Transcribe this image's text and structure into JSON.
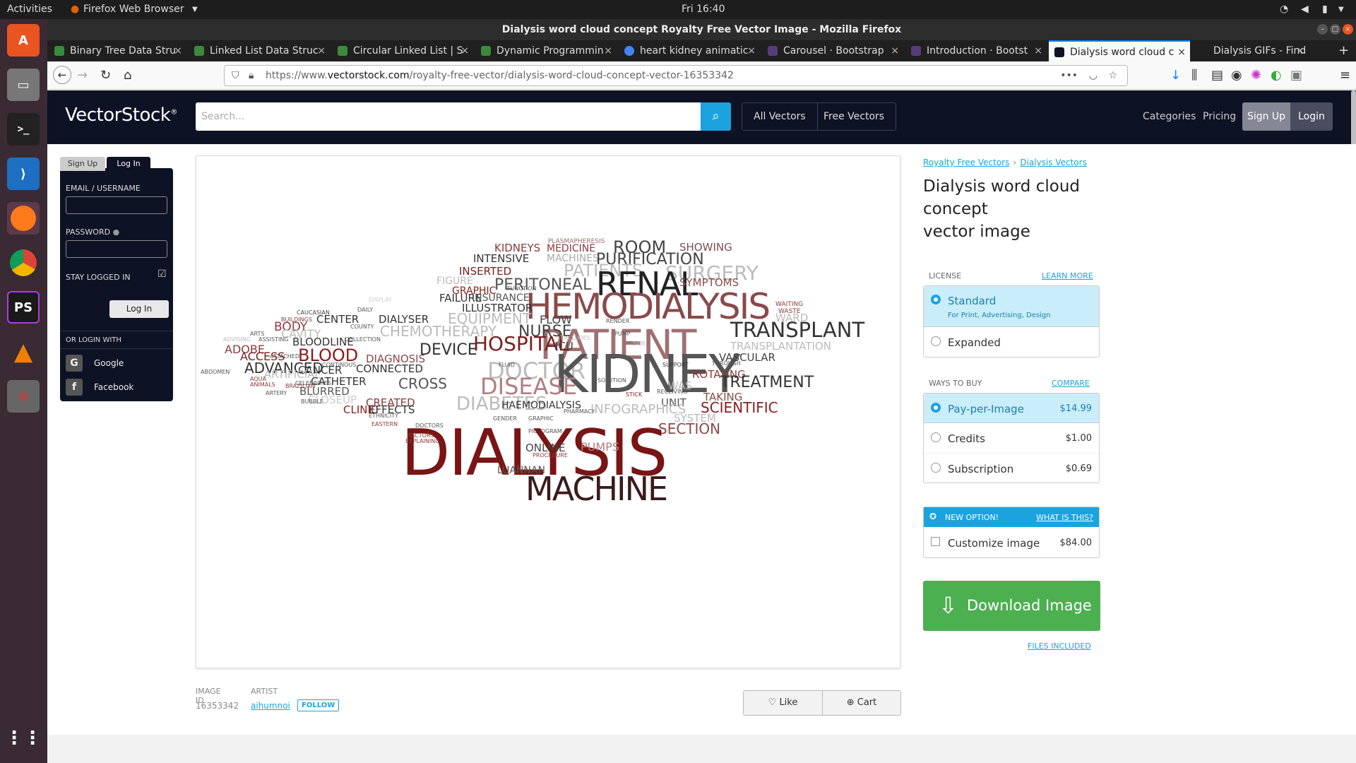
{
  "topbar": {
    "activities": "Activities",
    "app": "Firefox Web Browser",
    "clock": "Fri 16:40"
  },
  "window": {
    "title": "Dialysis word cloud concept Royalty Free Vector Image - Mozilla Firefox"
  },
  "tabs": [
    {
      "label": "Binary Tree Data Stru"
    },
    {
      "label": "Linked List Data Struc"
    },
    {
      "label": "Circular Linked List | S"
    },
    {
      "label": "Dynamic Programmin"
    },
    {
      "label": "heart kidney animatic"
    },
    {
      "label": "Carousel · Bootstrap"
    },
    {
      "label": "Introduction · Bootst"
    },
    {
      "label": "Dialysis word cloud c"
    },
    {
      "label": "Dialysis GIFs - Find &"
    }
  ],
  "url": {
    "prefix": "https://www.",
    "domain": "vectorstock.com",
    "path": "/royalty-free-vector/dialysis-word-cloud-concept-vector-16353342"
  },
  "site": {
    "logo": "VectorStock",
    "logo_mark": "®",
    "search_placeholder": "Search...",
    "all_vectors": "All Vectors",
    "free_vectors": "Free Vectors",
    "categories": "Categories",
    "pricing": "Pricing",
    "sign_up": "Sign Up",
    "login": "Login"
  },
  "login_panel": {
    "tab_signup": "Sign Up",
    "tab_login": "Log In",
    "email_label": "EMAIL / USERNAME",
    "password_label": "PASSWORD",
    "stay_logged": "STAY LOGGED IN",
    "login_btn": "Log In",
    "or_login": "OR LOGIN WITH",
    "google": "Google",
    "facebook": "Facebook"
  },
  "meta": {
    "image_id_label": "IMAGE ID",
    "image_id": "16353342",
    "artist_label": "ARTIST",
    "artist": "aihumnoi",
    "follow": "FOLLOW",
    "like": "Like",
    "cart": "Cart"
  },
  "details": {
    "crumb1": "Royalty Free Vectors",
    "crumb_sep": "›",
    "crumb2": "Dialysis Vectors",
    "title1": "Dialysis word cloud",
    "title2": "concept",
    "title3": "vector image",
    "license_label": "LICENSE",
    "learn_more": "LEARN MORE",
    "standard": "Standard",
    "standard_sub": "For Print, Advertising, Design",
    "expanded": "Expanded",
    "ways_label": "WAYS TO BUY",
    "compare": "COMPARE",
    "ppi": "Pay-per-Image",
    "ppi_price": "$14.99",
    "credits": "Credits",
    "credits_price": "$1.00",
    "subscription": "Subscription",
    "subscription_price": "$0.69",
    "new_option": "NEW OPTION!",
    "what_is": "WHAT IS THIS?",
    "customize": "Customize image",
    "customize_price": "$84.00",
    "download": "Download Image",
    "files_included": "FILES INCLUDED"
  },
  "cloud_words": [
    {
      "t": "KIDNEYS",
      "c": "#8a3a3a"
    },
    {
      "t": "PLASMAPHERESIS",
      "c": "#9b6b6b"
    },
    {
      "t": "ROOM",
      "c": "#444"
    },
    {
      "t": "SHOWING",
      "c": "#7a5050"
    },
    {
      "t": "INTENSIVE",
      "c": "#333"
    },
    {
      "t": "MACHINES",
      "c": "#aaa"
    },
    {
      "t": "MEDICINE",
      "c": "#8a3a3a"
    },
    {
      "t": "PURIFICATION",
      "c": "#444"
    },
    {
      "t": "PATIENTS",
      "c": "#bbb"
    },
    {
      "t": "SURGERY",
      "c": "#bbb"
    },
    {
      "t": "INSERTED",
      "c": "#7a2020"
    },
    {
      "t": "RENAL",
      "c": "#222"
    },
    {
      "t": "FIGURE",
      "c": "#bbb"
    },
    {
      "t": "PERITONEAL",
      "c": "#555"
    },
    {
      "t": "SYMPTOMS",
      "c": "#8a4a4a"
    },
    {
      "t": "GRAPHIC",
      "c": "#8a2020"
    },
    {
      "t": "FUNCTION",
      "c": "#555"
    },
    {
      "t": "HEMODIALYSIS",
      "c": "#8a4a4a"
    },
    {
      "t": "FAILURE",
      "c": "#333"
    },
    {
      "t": "INSURANCE",
      "c": "#555"
    },
    {
      "t": "ILLUSTRATOR",
      "c": "#333"
    },
    {
      "t": "WAITING",
      "c": "#8a3a3a"
    },
    {
      "t": "WASTE",
      "c": "#8a3a3a"
    },
    {
      "t": "DISPLAY",
      "c": "#ccc"
    },
    {
      "t": "WARD",
      "c": "#bbb"
    },
    {
      "t": "CAUCASIAN",
      "c": "#444"
    },
    {
      "t": "DAILY",
      "c": "#555"
    },
    {
      "t": "EQUIPMENT",
      "c": "#bbb"
    },
    {
      "t": "FLOW",
      "c": "#444"
    },
    {
      "t": "BUILDINGS",
      "c": "#8a3a3a"
    },
    {
      "t": "CENTER",
      "c": "#333"
    },
    {
      "t": "DIALYSER",
      "c": "#333"
    },
    {
      "t": "RENDER",
      "c": "#555"
    },
    {
      "t": "PATIENT",
      "c": "#a07070"
    },
    {
      "t": "TRANSPLANT",
      "c": "#333"
    },
    {
      "t": "BODY",
      "c": "#8a3a3a"
    },
    {
      "t": "COUNTY",
      "c": "#555"
    },
    {
      "t": "CHEMOTHERAPY",
      "c": "#bbb"
    },
    {
      "t": "NURSE",
      "c": "#444"
    },
    {
      "t": "ARTS",
      "c": "#555"
    },
    {
      "t": "CAVITY",
      "c": "#bbb"
    },
    {
      "t": "PUMP",
      "c": "#555"
    },
    {
      "t": "ADVISING",
      "c": "#bbb"
    },
    {
      "t": "ASSISTING",
      "c": "#555"
    },
    {
      "t": "BLOODLINE",
      "c": "#333"
    },
    {
      "t": "COLLECTION",
      "c": "#555"
    },
    {
      "t": "HOSPITAL",
      "c": "#7a2020"
    },
    {
      "t": "EXCLUDES",
      "c": "#bbb"
    },
    {
      "t": "ICU",
      "c": "#444"
    },
    {
      "t": "SIDE",
      "c": "#bbb"
    },
    {
      "t": "TRANSPLANTATION",
      "c": "#bbb"
    },
    {
      "t": "ADOBE",
      "c": "#8a3a3a"
    },
    {
      "t": "DEVICE",
      "c": "#333"
    },
    {
      "t": "ACCESS",
      "c": "#7a2020"
    },
    {
      "t": "ATTACHED",
      "c": "#555"
    },
    {
      "t": "BLOOD",
      "c": "#8a1a1a"
    },
    {
      "t": "DIAGNOSIS",
      "c": "#8a4a4a"
    },
    {
      "t": "DOCTOR",
      "c": "#bbb"
    },
    {
      "t": "KIDNEY",
      "c": "#555"
    },
    {
      "t": "VASCULAR",
      "c": "#444"
    },
    {
      "t": "ADVANCED",
      "c": "#333"
    },
    {
      "t": "CONTINOUS",
      "c": "#555"
    },
    {
      "t": "CANCER",
      "c": "#333"
    },
    {
      "t": "CONNECTED",
      "c": "#333"
    },
    {
      "t": "SUPPORT",
      "c": "#333"
    },
    {
      "t": "FLUID",
      "c": "#555"
    },
    {
      "t": "THROUGH",
      "c": "#555"
    },
    {
      "t": "ABDOMEN",
      "c": "#555"
    },
    {
      "t": "ARTIFICIAL",
      "c": "#bbb"
    },
    {
      "t": "ROTATING",
      "c": "#8a3a3a"
    },
    {
      "t": "DISEASE",
      "c": "#b08080"
    },
    {
      "t": "CATHETER",
      "c": "#333"
    },
    {
      "t": "CROSS",
      "c": "#555"
    },
    {
      "t": "TREATMENT",
      "c": "#333"
    },
    {
      "t": "WAS",
      "c": "#bbb"
    },
    {
      "t": "BLURRED",
      "c": "#555"
    },
    {
      "t": "SOLUTION",
      "c": "#555"
    },
    {
      "t": "RECEIVING",
      "c": "#555"
    },
    {
      "t": "TAKING",
      "c": "#8a4a4a"
    },
    {
      "t": "DIABETES",
      "c": "#bbb"
    },
    {
      "t": "CLOSEUP",
      "c": "#ccc"
    },
    {
      "t": "CREATED",
      "c": "#8a3a3a"
    },
    {
      "t": "STICK",
      "c": "#8a2020"
    },
    {
      "t": "UNIT",
      "c": "#555"
    },
    {
      "t": "SCIENTIFIC",
      "c": "#8a2020"
    },
    {
      "t": "CLINIC",
      "c": "#8a2020"
    },
    {
      "t": "EFFECTS",
      "c": "#333"
    },
    {
      "t": "HAEMODIALYSIS",
      "c": "#333"
    },
    {
      "t": "INFOGRAPHICS",
      "c": "#bbb"
    },
    {
      "t": "SYSTEM",
      "c": "#bbb"
    },
    {
      "t": "GENDER",
      "c": "#555"
    },
    {
      "t": "PHARMACY",
      "c": "#555"
    },
    {
      "t": "DOCTORS",
      "c": "#555"
    },
    {
      "t": "GRAPHIC",
      "c": "#555"
    },
    {
      "t": "SECTION",
      "c": "#8a4a4a"
    },
    {
      "t": "PICTOGRAM",
      "c": "#555"
    },
    {
      "t": "DIALYSIS",
      "c": "#7a1515"
    },
    {
      "t": "ONLINE",
      "c": "#444"
    },
    {
      "t": "PUMPS",
      "c": "#b08080"
    },
    {
      "t": "PROCEDURE",
      "c": "#8a3a3a"
    },
    {
      "t": "FACTORS",
      "c": "#8a3a3a"
    },
    {
      "t": "EXPLAINING",
      "c": "#8a3a3a"
    },
    {
      "t": "LUANNAN",
      "c": "#555"
    },
    {
      "t": "MACHINE",
      "c": "#3a1a1a"
    },
    {
      "t": "BUBBLE",
      "c": "#555"
    },
    {
      "t": "ETHNICITY",
      "c": "#555"
    },
    {
      "t": "EASTERN",
      "c": "#8a3a3a"
    },
    {
      "t": "AQUA",
      "c": "#8a3a3a"
    },
    {
      "t": "ANIMALS",
      "c": "#8a3a3a"
    },
    {
      "t": "BRAZILIAN",
      "c": "#8a3a3a"
    },
    {
      "t": "CELEBRITIES",
      "c": "#555"
    },
    {
      "t": "ARTERY",
      "c": "#555"
    }
  ],
  "colors": {
    "accent": "#1ba3e0",
    "download": "#4caf50",
    "header": "#0e1225"
  }
}
